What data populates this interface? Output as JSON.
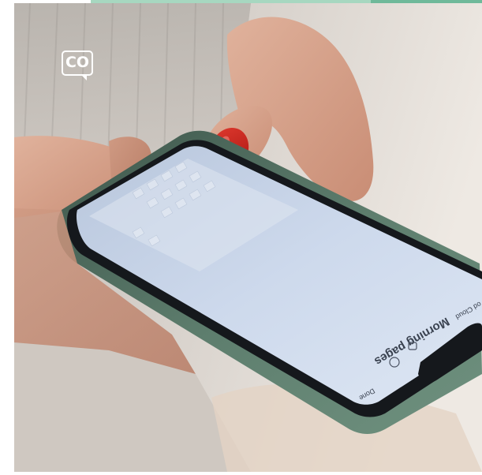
{
  "image": {
    "description_free": true,
    "colors": {
      "top_strip": "#a7d7c0",
      "top_strip_dark": "#6fb99a",
      "phone_case": "#4f6b5d",
      "screen": "#c8d6ea",
      "nail_polish": "#c8211d",
      "skin": "#d9a58d",
      "background": "#d8d2cc"
    }
  },
  "logo": {
    "text": "CO",
    "icon": "speech-bubble-icon"
  },
  "phone_screen": {
    "note_title": "Morning pages",
    "label_bottom": "Done",
    "label_side": "od Cloud"
  }
}
